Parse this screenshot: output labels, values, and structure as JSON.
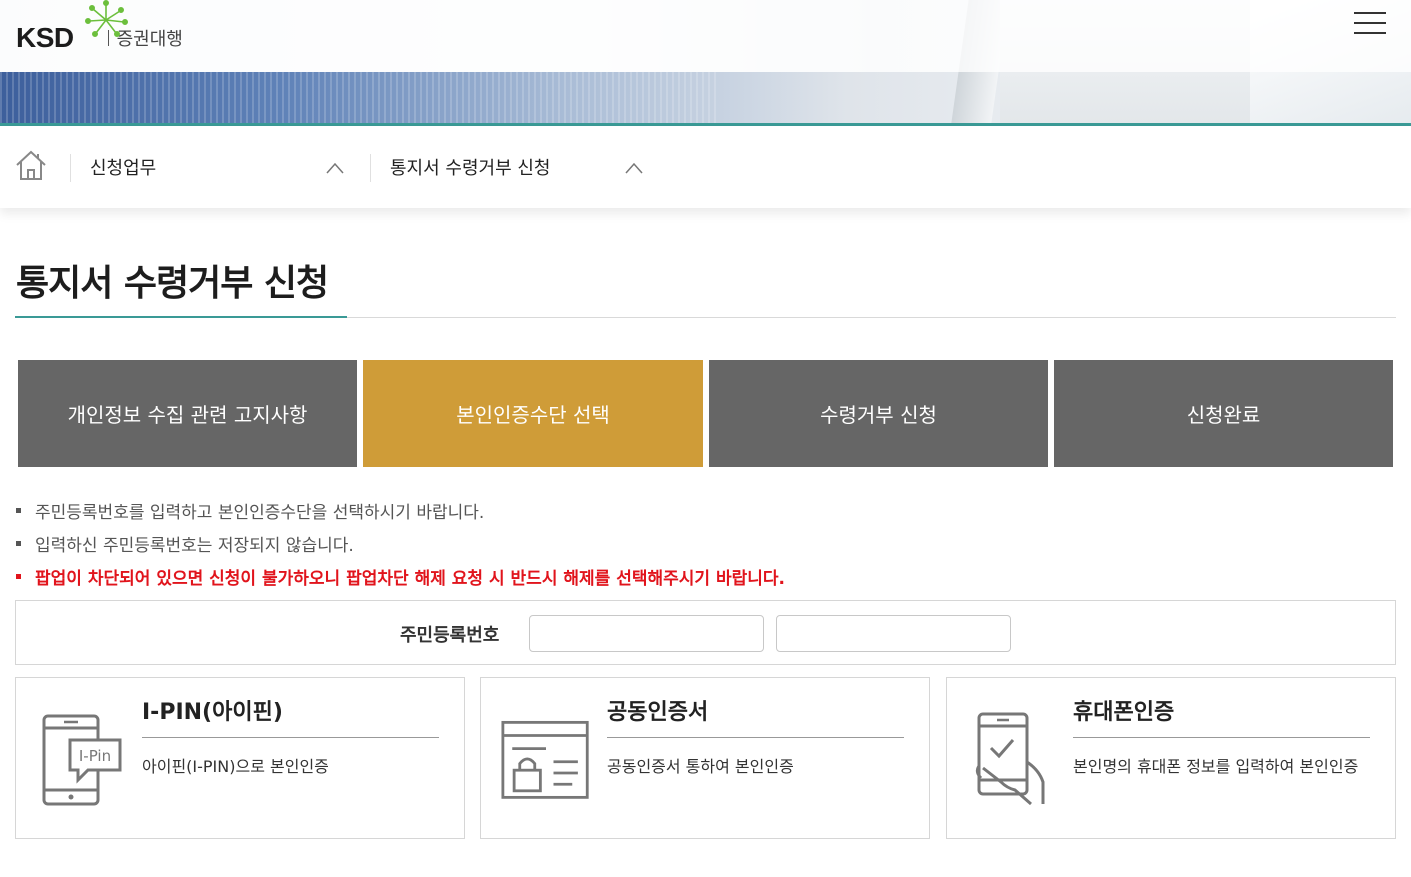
{
  "header": {
    "logo_text": "KSD",
    "logo_sub": "증권대행"
  },
  "breadcrumb": {
    "items": [
      {
        "label": "신청업무"
      },
      {
        "label": "통지서 수령거부 신청"
      }
    ]
  },
  "page_title": "통지서 수령거부 신청",
  "steps": [
    {
      "label": "개인정보 수집 관련 고지사항",
      "active": false
    },
    {
      "label": "본인인증수단 선택",
      "active": true
    },
    {
      "label": "수령거부 신청",
      "active": false
    },
    {
      "label": "신청완료",
      "active": false
    }
  ],
  "notes": [
    {
      "text": "주민등록번호를 입력하고 본인인증수단을 선택하시기 바랍니다.",
      "warning": false
    },
    {
      "text": "입력하신 주민등록번호는 저장되지 않습니다.",
      "warning": false
    },
    {
      "text": "팝업이 차단되어 있으면 신청이 불가하오니 팝업차단 해제 요청 시 반드시 해제를 선택해주시기 바랍니다.",
      "warning": true
    }
  ],
  "rrn": {
    "label": "주민등록번호",
    "first_value": "",
    "second_value": ""
  },
  "auth_methods": [
    {
      "title": "I-PIN(아이핀)",
      "desc": "아이핀(I-PIN)으로 본인인증",
      "icon": "ipin-phone-icon",
      "icon_badge": "I-Pin"
    },
    {
      "title": "공동인증서",
      "desc": "공동인증서 통하여 본인인증",
      "icon": "certificate-lock-icon"
    },
    {
      "title": "휴대폰인증",
      "desc": "본인명의 휴대폰 정보를 입력하여 본인인증",
      "icon": "hand-phone-check-icon"
    }
  ],
  "colors": {
    "accent_teal": "#3a9a96",
    "step_active": "#cf9c38",
    "step_inactive": "#666666",
    "warning_red": "#e1141c"
  }
}
